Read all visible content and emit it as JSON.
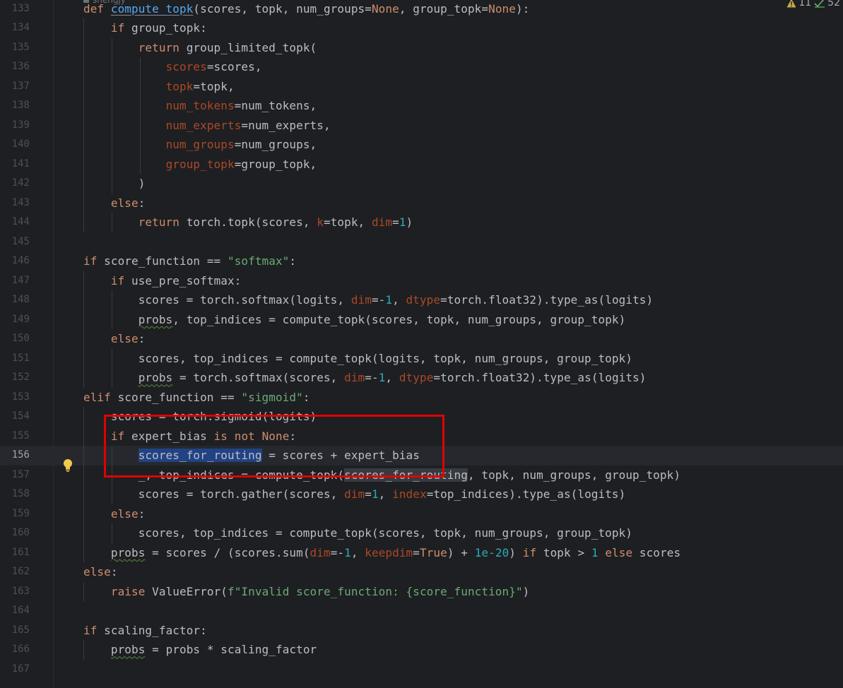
{
  "editor": {
    "author_hint": "shengjy",
    "inspections": {
      "warnings": "11",
      "weak_warnings": "52"
    },
    "current_line": 156
  },
  "lines": [
    {
      "n": "133",
      "code": "def compute_topk(scores, topk, num_groups=None, group_topk=None):"
    },
    {
      "n": "134",
      "code": "    if group_topk:"
    },
    {
      "n": "135",
      "code": "        return group_limited_topk("
    },
    {
      "n": "136",
      "code": "            scores=scores,"
    },
    {
      "n": "137",
      "code": "            topk=topk,"
    },
    {
      "n": "138",
      "code": "            num_tokens=num_tokens,"
    },
    {
      "n": "139",
      "code": "            num_experts=num_experts,"
    },
    {
      "n": "140",
      "code": "            num_groups=num_groups,"
    },
    {
      "n": "141",
      "code": "            group_topk=group_topk,"
    },
    {
      "n": "142",
      "code": "        )"
    },
    {
      "n": "143",
      "code": "    else:"
    },
    {
      "n": "144",
      "code": "        return torch.topk(scores, k=topk, dim=1)"
    },
    {
      "n": "145",
      "code": ""
    },
    {
      "n": "146",
      "code": "if score_function == \"softmax\":"
    },
    {
      "n": "147",
      "code": "    if use_pre_softmax:"
    },
    {
      "n": "148",
      "code": "        scores = torch.softmax(logits, dim=-1, dtype=torch.float32).type_as(logits)"
    },
    {
      "n": "149",
      "code": "        probs, top_indices = compute_topk(scores, topk, num_groups, group_topk)"
    },
    {
      "n": "150",
      "code": "    else:"
    },
    {
      "n": "151",
      "code": "        scores, top_indices = compute_topk(logits, topk, num_groups, group_topk)"
    },
    {
      "n": "152",
      "code": "        probs = torch.softmax(scores, dim=-1, dtype=torch.float32).type_as(logits)"
    },
    {
      "n": "153",
      "code": "elif score_function == \"sigmoid\":"
    },
    {
      "n": "154",
      "code": "    scores = torch.sigmoid(logits)"
    },
    {
      "n": "155",
      "code": "    if expert_bias is not None:"
    },
    {
      "n": "156",
      "code": "        scores_for_routing = scores + expert_bias"
    },
    {
      "n": "157",
      "code": "        _, top_indices = compute_topk(scores_for_routing, topk, num_groups, group_topk)"
    },
    {
      "n": "158",
      "code": "        scores = torch.gather(scores, dim=1, index=top_indices).type_as(logits)"
    },
    {
      "n": "159",
      "code": "    else:"
    },
    {
      "n": "160",
      "code": "        scores, top_indices = compute_topk(scores, topk, num_groups, group_topk)"
    },
    {
      "n": "161",
      "code": "    probs = scores / (scores.sum(dim=-1, keepdim=True) + 1e-20) if topk > 1 else scores"
    },
    {
      "n": "162",
      "code": "else:"
    },
    {
      "n": "163",
      "code": "    raise ValueError(f\"Invalid score_function: {score_function}\")"
    },
    {
      "n": "164",
      "code": ""
    },
    {
      "n": "165",
      "code": "if scaling_factor:"
    },
    {
      "n": "166",
      "code": "    probs = probs * scaling_factor"
    },
    {
      "n": "167",
      "code": ""
    }
  ],
  "colors": {
    "background": "#1e1f22",
    "keyword": "#cf8e6d",
    "function": "#56a8f5",
    "string": "#6aab73",
    "number": "#2aacb8",
    "named_param": "#aa4926",
    "selection": "#214283",
    "annotation_box": "#e10000"
  },
  "icons": {
    "gutter_action": "lightbulb-icon",
    "warnings": "warning-triangle-icon",
    "weak_warnings": "double-check-icon"
  }
}
